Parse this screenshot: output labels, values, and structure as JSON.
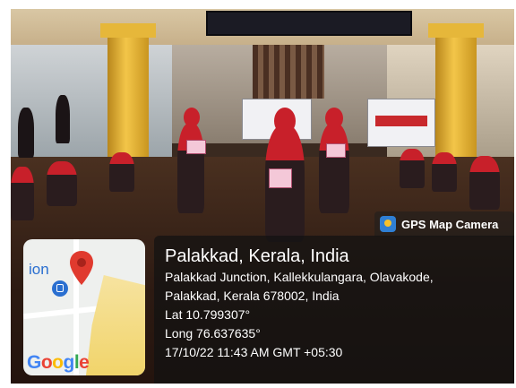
{
  "overlay": {
    "camera_label": "GPS Map Camera",
    "location_title": "Palakkad, Kerala, India",
    "address_line1": "Palakkad Junction, Kallekkulangara, Olavakode,",
    "address_line2": "Palakkad, Kerala 678002, India",
    "latitude": "Lat 10.799307°",
    "longitude": "Long 76.637635°",
    "timestamp": "17/10/22 11:43 AM GMT +05:30"
  },
  "map": {
    "partial_label": "ion",
    "logo_text": "Google",
    "pin_color": "#e03a2e",
    "transit_color": "#2a6fd0"
  },
  "colors": {
    "pillar": "#f3c649",
    "dupatta_red": "#c8202a",
    "panel_bg": "#121212"
  }
}
